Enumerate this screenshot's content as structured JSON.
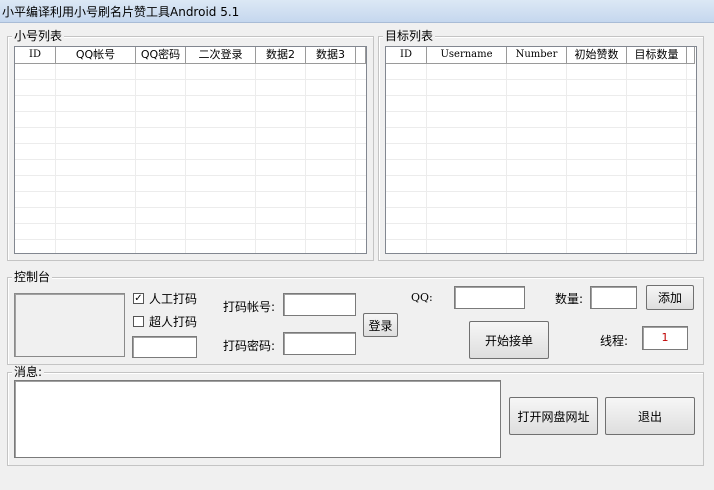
{
  "window": {
    "title": "小平编译利用小号刷名片赞工具Android 5.1"
  },
  "accounts": {
    "label": "小号列表",
    "columns": [
      "ID",
      "QQ帐号",
      "QQ密码",
      "二次登录",
      "数据2",
      "数据3"
    ]
  },
  "targets": {
    "label": "目标列表",
    "columns": [
      "ID",
      "Username",
      "Number",
      "初始赞数",
      "目标数量"
    ]
  },
  "console": {
    "label": "控制台",
    "manual_captcha": {
      "label": "人工打码",
      "checked": true
    },
    "chaoren_captcha": {
      "label": "超人打码",
      "checked": false
    },
    "captcha_account_label": "打码帐号:",
    "captcha_password_label": "打码密码:",
    "login_button": "登录",
    "qq_label": "QQ:",
    "count_label": "数量:",
    "add_button": "添加",
    "start_button": "开始接单",
    "threads_label": "线程:",
    "threads_value": "1"
  },
  "messages": {
    "label": "消息:",
    "open_disk_button": "打开网盘网址",
    "exit_button": "退出"
  }
}
